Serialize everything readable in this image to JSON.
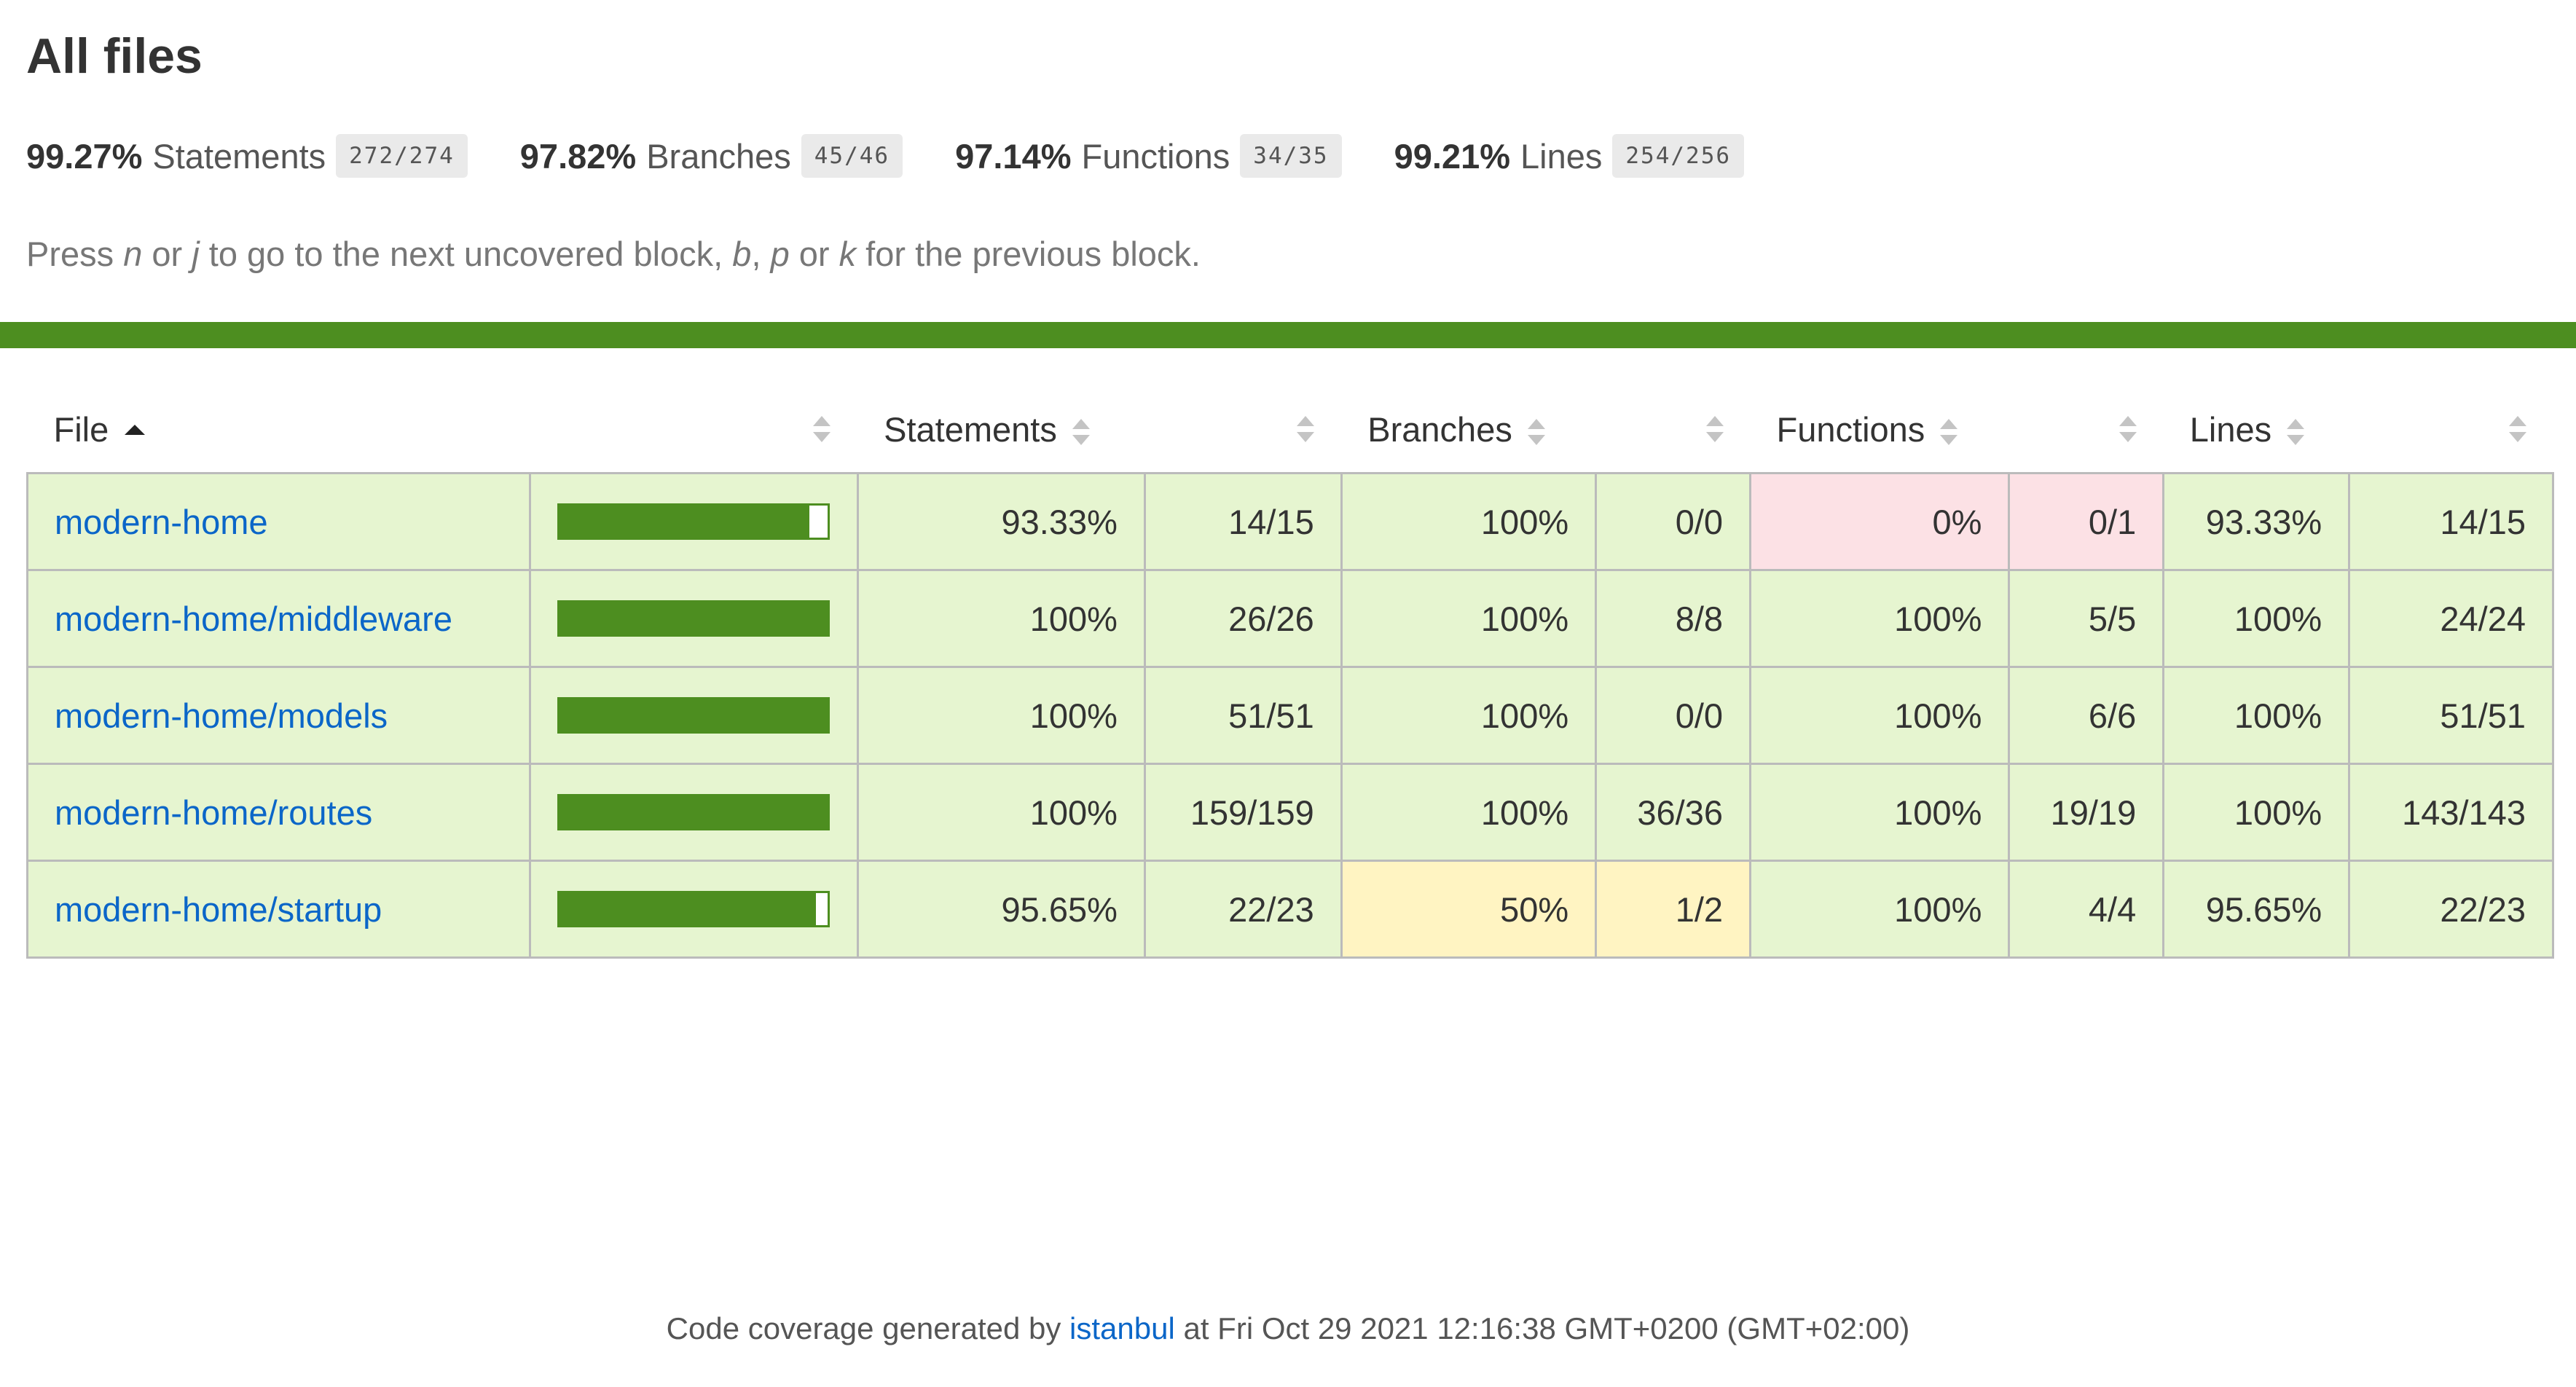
{
  "page": {
    "title": "All files"
  },
  "summary": [
    {
      "pct": "99.27%",
      "label": "Statements",
      "fraction": "272/274"
    },
    {
      "pct": "97.82%",
      "label": "Branches",
      "fraction": "45/46"
    },
    {
      "pct": "97.14%",
      "label": "Functions",
      "fraction": "34/35"
    },
    {
      "pct": "99.21%",
      "label": "Lines",
      "fraction": "254/256"
    }
  ],
  "hint": {
    "p1": "Press ",
    "k1": "n",
    "p2": " or ",
    "k2": "j",
    "p3": " to go to the next uncovered block, ",
    "k3": "b",
    "p4": ", ",
    "k4": "p",
    "p5": " or ",
    "k5": "k",
    "p6": " for the previous block."
  },
  "table": {
    "headers": {
      "file": "File",
      "statements": "Statements",
      "branches": "Branches",
      "functions": "Functions",
      "lines": "Lines"
    },
    "rows": [
      {
        "file": "modern-home",
        "bar_fraction": 0.9333,
        "stmt_pct": "93.33%",
        "stmt_frac": "14/15",
        "br_pct": "100%",
        "br_frac": "0/0",
        "fn_pct": "0%",
        "fn_frac": "0/1",
        "ln_pct": "93.33%",
        "ln_frac": "14/15",
        "classes": {
          "stmt": "high",
          "br": "high",
          "fn": "low",
          "ln": "high"
        }
      },
      {
        "file": "modern-home/middleware",
        "bar_fraction": 1.0,
        "stmt_pct": "100%",
        "stmt_frac": "26/26",
        "br_pct": "100%",
        "br_frac": "8/8",
        "fn_pct": "100%",
        "fn_frac": "5/5",
        "ln_pct": "100%",
        "ln_frac": "24/24",
        "classes": {
          "stmt": "high",
          "br": "high",
          "fn": "high",
          "ln": "high"
        }
      },
      {
        "file": "modern-home/models",
        "bar_fraction": 1.0,
        "stmt_pct": "100%",
        "stmt_frac": "51/51",
        "br_pct": "100%",
        "br_frac": "0/0",
        "fn_pct": "100%",
        "fn_frac": "6/6",
        "ln_pct": "100%",
        "ln_frac": "51/51",
        "classes": {
          "stmt": "high",
          "br": "high",
          "fn": "high",
          "ln": "high"
        }
      },
      {
        "file": "modern-home/routes",
        "bar_fraction": 1.0,
        "stmt_pct": "100%",
        "stmt_frac": "159/159",
        "br_pct": "100%",
        "br_frac": "36/36",
        "fn_pct": "100%",
        "fn_frac": "19/19",
        "ln_pct": "100%",
        "ln_frac": "143/143",
        "classes": {
          "stmt": "high",
          "br": "high",
          "fn": "high",
          "ln": "high"
        }
      },
      {
        "file": "modern-home/startup",
        "bar_fraction": 0.9565,
        "stmt_pct": "95.65%",
        "stmt_frac": "22/23",
        "br_pct": "50%",
        "br_frac": "1/2",
        "fn_pct": "100%",
        "fn_frac": "4/4",
        "ln_pct": "95.65%",
        "ln_frac": "22/23",
        "classes": {
          "stmt": "high",
          "br": "medium",
          "fn": "high",
          "ln": "high"
        }
      }
    ]
  },
  "footer": {
    "prefix": "Code coverage generated by ",
    "link": "istanbul",
    "suffix": " at Fri Oct 29 2021 12:16:38 GMT+0200 (GMT+02:00)"
  },
  "colors": {
    "high": "#e6f5d0",
    "low": "#fce1e5",
    "medium": "#fff4c2",
    "bar": "#4d8e20",
    "link": "#0b66c8"
  },
  "icons": {
    "sort_asc": "sort-ascending-icon",
    "sort_neutral": "sort-icon"
  }
}
